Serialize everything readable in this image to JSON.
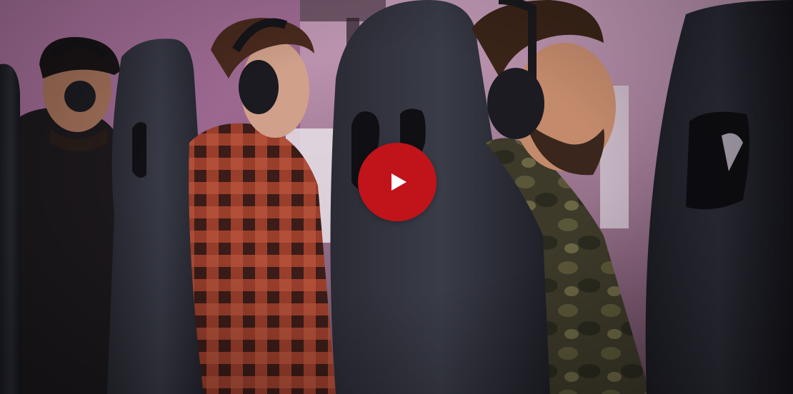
{
  "video": {
    "thumbnail_description_icon": "gaming-cafe-photo",
    "play_icon": "play-icon",
    "play_button_color": "#c0141a",
    "play_icon_color": "#ffffff"
  }
}
